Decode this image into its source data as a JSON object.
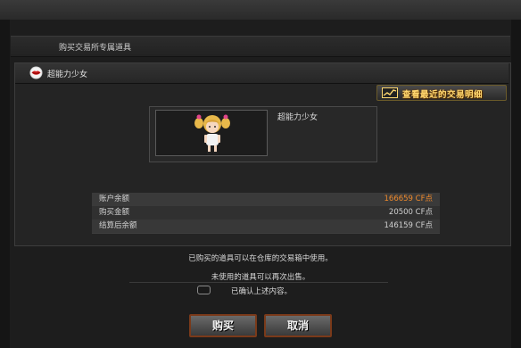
{
  "dialog": {
    "title": "购买交易所专属道具"
  },
  "item": {
    "header_name": "超能力少女",
    "name": "超能力少女"
  },
  "trade_history_button": {
    "label": "查看最近的交易明细"
  },
  "summary": {
    "rows": [
      {
        "label": "账户余额",
        "value": "166659 CF点"
      },
      {
        "label": "购买金额",
        "value": "20500 CF点"
      },
      {
        "label": "结算后余额",
        "value": "146159 CF点"
      }
    ],
    "balance_color": "#f08a2c"
  },
  "notes": {
    "line1": "已购买的道具可以在仓库的交易箱中使用。",
    "line2": "未使用的道具可以再次出售。"
  },
  "confirm": {
    "label": "已确认上述内容。",
    "checked": false
  },
  "buttons": {
    "buy": "购买",
    "cancel": "取消"
  }
}
